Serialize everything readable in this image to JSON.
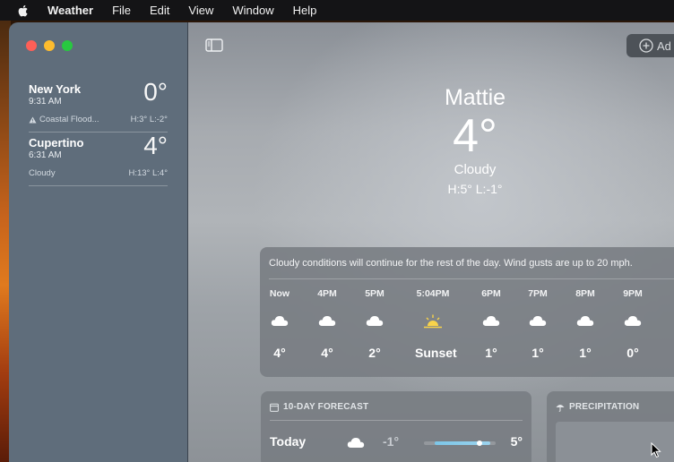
{
  "menubar": {
    "app_name": "Weather",
    "items": [
      "File",
      "Edit",
      "View",
      "Window",
      "Help"
    ]
  },
  "sidebar": {
    "locations": [
      {
        "city": "New York",
        "time": "9:31 AM",
        "temp": "0°",
        "condition": "Coastal Flood...",
        "hilo": "H:3°  L:-2°",
        "alert_icon": "warning-triangle-icon"
      },
      {
        "city": "Cupertino",
        "time": "6:31 AM",
        "temp": "4°",
        "condition": "Cloudy",
        "hilo": "H:13°  L:4°"
      }
    ]
  },
  "toolbar": {
    "add_label": "Ad"
  },
  "current": {
    "location": "Mattie",
    "temp": "4°",
    "condition": "Cloudy",
    "hilo": "H:5°  L:-1°"
  },
  "hourly": {
    "summary": "Cloudy conditions will continue for the rest of the day. Wind gusts are up to 20 mph.",
    "hours": [
      {
        "label": "Now",
        "icon": "cloud-icon",
        "temp": "4°"
      },
      {
        "label": "4PM",
        "icon": "cloud-icon",
        "temp": "4°"
      },
      {
        "label": "5PM",
        "icon": "cloud-icon",
        "temp": "2°"
      },
      {
        "label": "5:04PM",
        "icon": "sunset-icon",
        "temp": "Sunset"
      },
      {
        "label": "6PM",
        "icon": "cloud-icon",
        "temp": "1°"
      },
      {
        "label": "7PM",
        "icon": "cloud-icon",
        "temp": "1°"
      },
      {
        "label": "8PM",
        "icon": "cloud-icon",
        "temp": "1°"
      },
      {
        "label": "9PM",
        "icon": "cloud-icon",
        "temp": "0°"
      }
    ]
  },
  "forecast": {
    "title": "10-DAY FORECAST",
    "rows": [
      {
        "day": "Today",
        "icon": "cloud-icon",
        "low": "-1°",
        "high": "5°"
      }
    ]
  },
  "precipitation": {
    "title": "PRECIPITATION"
  },
  "colors": {
    "sidebar_bg": "#5f6d7b",
    "temp_bar_start": "#7cc6e8",
    "temp_bar_end": "#9bd3ee"
  }
}
